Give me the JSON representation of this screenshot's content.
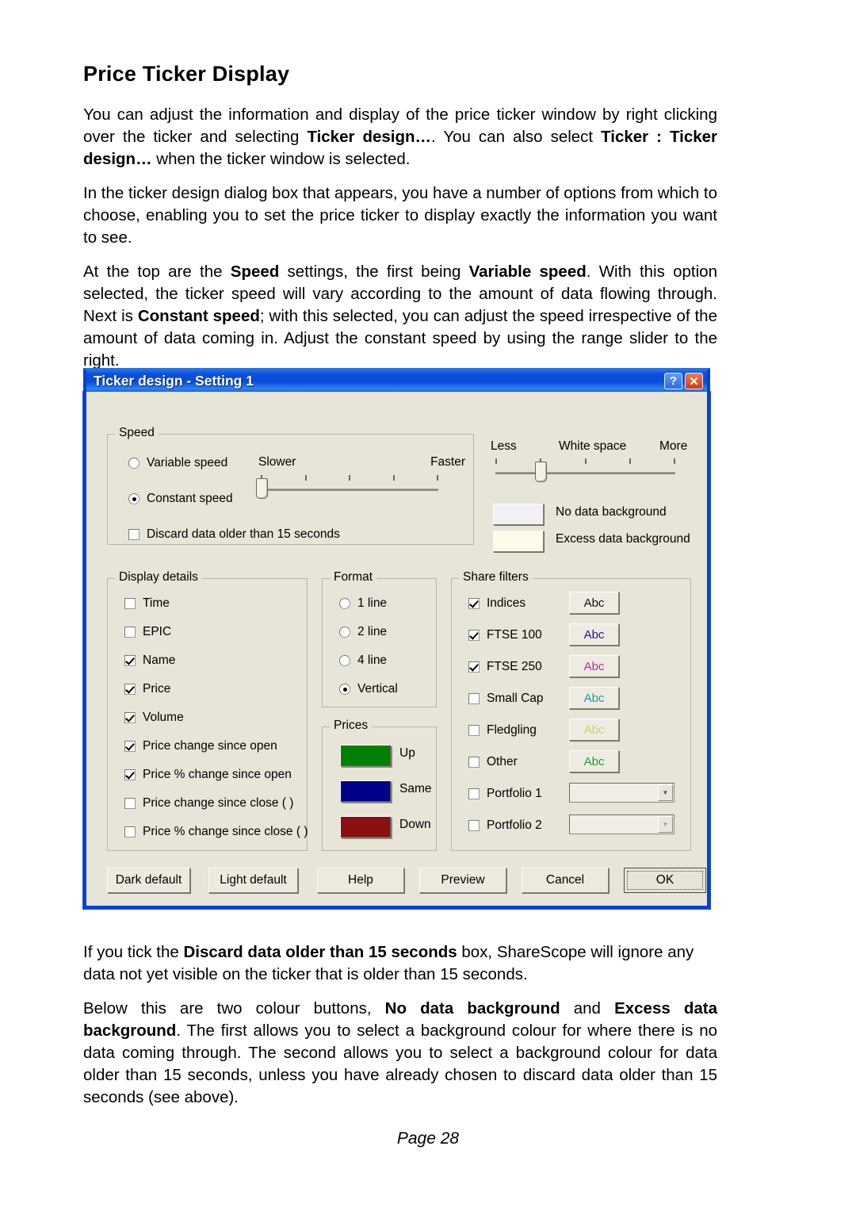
{
  "document": {
    "heading": "Price Ticker Display",
    "paragraphs": [
      {
        "id": "p1",
        "runs": [
          {
            "t": "You can adjust the information and display of the price ticker window by right clicking over the ticker and selecting ",
            "b": false
          },
          {
            "t": "Ticker design…",
            "b": true
          },
          {
            "t": ". You can also select ",
            "b": false
          },
          {
            "t": "Ticker : Ticker design…",
            "b": true
          },
          {
            "t": " when the ticker window is selected.",
            "b": false
          }
        ]
      },
      {
        "id": "p2",
        "runs": [
          {
            "t": "In the ticker design dialog box that appears, you have a number of options from which to choose, enabling you to set the price ticker to display exactly the information you want to see.",
            "b": false
          }
        ]
      },
      {
        "id": "p3",
        "runs": [
          {
            "t": "At the top are the ",
            "b": false
          },
          {
            "t": "Speed",
            "b": true
          },
          {
            "t": " settings, the first being ",
            "b": false
          },
          {
            "t": "Variable speed",
            "b": true
          },
          {
            "t": ". With this option selected, the ticker speed will vary according to the amount of data flowing through. Next is ",
            "b": false
          },
          {
            "t": "Constant speed",
            "b": true
          },
          {
            "t": "; with this selected, you can adjust the speed irrespective of the amount of data coming in. Adjust the constant speed by using the range slider to the right.",
            "b": false
          }
        ]
      },
      {
        "id": "p4",
        "runs": [
          {
            "t": "If you tick the ",
            "b": false
          },
          {
            "t": "Discard data older than 15 seconds",
            "b": true
          },
          {
            "t": " box, ShareScope will ignore any data not yet visible on the ticker that is older than 15 seconds.",
            "b": false
          }
        ]
      },
      {
        "id": "p5",
        "runs": [
          {
            "t": "Below this are two colour buttons, ",
            "b": false
          },
          {
            "t": "No data background",
            "b": true
          },
          {
            "t": " and ",
            "b": false
          },
          {
            "t": "Excess data background",
            "b": true
          },
          {
            "t": ".  The first allows you to select a background colour for where there is no data coming through.  The second allows you to select a background colour for data older than 15 seconds, unless you have already chosen to discard data older than 15 seconds (see above).",
            "b": false
          }
        ]
      }
    ],
    "footer": "Page 28"
  },
  "dialog": {
    "title": "Ticker design - Setting 1",
    "titlebar_buttons": [
      {
        "name": "help-button",
        "glyph": "?"
      },
      {
        "name": "close-button",
        "glyph": "✕"
      }
    ],
    "speed_group": {
      "legend": "Speed",
      "options": [
        {
          "label": "Variable speed",
          "selected": false
        },
        {
          "label": "Constant speed",
          "selected": true
        }
      ],
      "discard_checkbox": {
        "label": "Discard data older than 15 seconds",
        "checked": false
      },
      "slider": {
        "left_label": "Slower",
        "right_label": "Faster",
        "ticks": 5,
        "value_index": 0
      }
    },
    "whitespace": {
      "left_label": "Less",
      "center_label": "White space",
      "right_label": "More",
      "ticks": 5,
      "value_index": 1,
      "color_buttons": [
        {
          "label": "No data background",
          "color": "#f0f0f5"
        },
        {
          "label": "Excess data background",
          "color": "#fdfce8"
        }
      ]
    },
    "display_details": {
      "legend": "Display details",
      "items": [
        {
          "label": "Time",
          "checked": false
        },
        {
          "label": "EPIC",
          "checked": false
        },
        {
          "label": "Name",
          "checked": true
        },
        {
          "label": "Price",
          "checked": true
        },
        {
          "label": "Volume",
          "checked": true
        },
        {
          "label": "Price change since open",
          "checked": true
        },
        {
          "label": "Price % change since open",
          "checked": true
        },
        {
          "label": "Price change since close ( )",
          "checked": false
        },
        {
          "label": "Price % change since close ( )",
          "checked": false
        }
      ]
    },
    "format": {
      "legend": "Format",
      "options": [
        {
          "label": "1 line",
          "selected": false
        },
        {
          "label": "2 line",
          "selected": false
        },
        {
          "label": "4 line",
          "selected": false
        },
        {
          "label": "Vertical",
          "selected": true
        }
      ]
    },
    "prices": {
      "legend": "Prices",
      "items": [
        {
          "label": "Up",
          "color": "#008000"
        },
        {
          "label": "Same",
          "color": "#00008b"
        },
        {
          "label": "Down",
          "color": "#8b1010"
        }
      ]
    },
    "share_filters": {
      "legend": "Share filters",
      "items": [
        {
          "label": "Indices",
          "checked": true,
          "control": "abc",
          "abc_label": "Abc",
          "abc_color": "#111111"
        },
        {
          "label": "FTSE 100",
          "checked": true,
          "control": "abc",
          "abc_label": "Abc",
          "abc_color": "#1b1b8f"
        },
        {
          "label": "FTSE 250",
          "checked": true,
          "control": "abc",
          "abc_label": "Abc",
          "abc_color": "#b0309a"
        },
        {
          "label": "Small Cap",
          "checked": false,
          "control": "abc",
          "abc_label": "Abc",
          "abc_color": "#1d9aa0"
        },
        {
          "label": "Fledgling",
          "checked": false,
          "control": "abc",
          "abc_label": "Abc",
          "abc_color": "#d6cb6a"
        },
        {
          "label": "Other",
          "checked": false,
          "control": "abc",
          "abc_label": "Abc",
          "abc_color": "#1f9b2f"
        },
        {
          "label": "Portfolio 1",
          "checked": false,
          "control": "combo",
          "combo_value": "",
          "disabled": false
        },
        {
          "label": "Portfolio 2",
          "checked": false,
          "control": "combo",
          "combo_value": "",
          "disabled": true
        }
      ]
    },
    "buttons": [
      {
        "label": "Dark default",
        "name": "dark-default-button",
        "default": false
      },
      {
        "label": "Light default",
        "name": "light-default-button",
        "default": false
      },
      {
        "label": "Help",
        "name": "help-button",
        "default": false
      },
      {
        "label": "Preview",
        "name": "preview-button",
        "default": false
      },
      {
        "label": "Cancel",
        "name": "cancel-button",
        "default": false
      },
      {
        "label": "OK",
        "name": "ok-button",
        "default": true
      }
    ]
  }
}
